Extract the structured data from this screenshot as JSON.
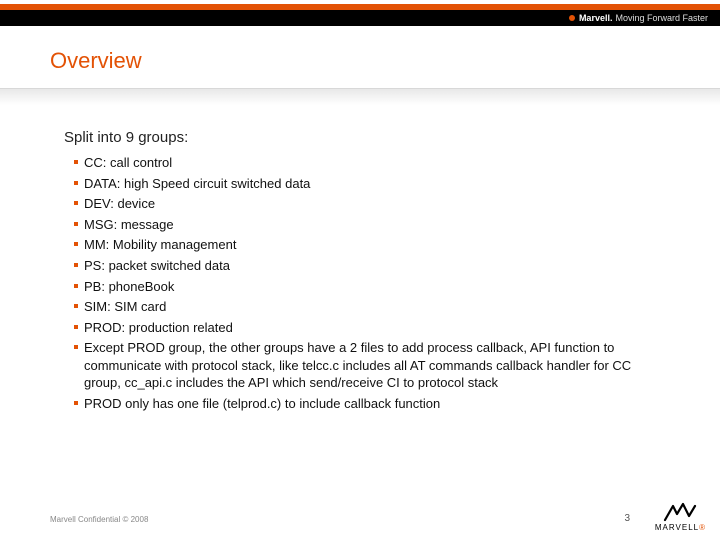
{
  "header": {
    "brand": "Marvell.",
    "tagline": "Moving Forward Faster"
  },
  "title": "Overview",
  "main_bullet": "Split into 9 groups:",
  "sub_items": [
    "CC: call control",
    "DATA: high Speed circuit switched data",
    "DEV: device",
    "MSG: message",
    "MM: Mobility management",
    "PS: packet switched data",
    "PB: phoneBook",
    "SIM: SIM card",
    "PROD: production related",
    "Except PROD group, the other groups have a 2 files to add process callback, API function to communicate with protocol stack, like telcc.c includes all AT commands callback handler for CC group, cc_api.c includes the API which send/receive CI to protocol stack",
    "PROD only has one file (telprod.c) to include callback function"
  ],
  "footer": "Marvell Confidential © 2008",
  "page_number": "3",
  "logo_text": "MARVELL"
}
